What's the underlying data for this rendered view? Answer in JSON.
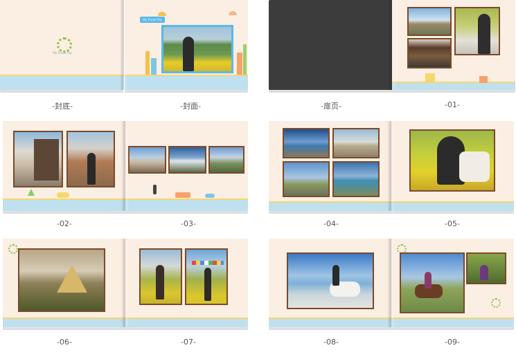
{
  "labels": {
    "back_cover": "-封底-",
    "front_cover": "-封面-",
    "title_page": "-扉页-",
    "p01": "-01-",
    "p02": "-02-",
    "p03": "-03-",
    "p04": "-04-",
    "p05": "-05-",
    "p06": "-06-",
    "p07": "-07-",
    "p08": "-08-",
    "p09": "-09-"
  },
  "cover": {
    "back_caption": "My Travel Trip",
    "front_caption": "My Travel Trip"
  },
  "colors": {
    "page": "#fbeee3",
    "stripe": "#bfe0ef",
    "frame": "#7a4a2a",
    "accent_blue": "#5bb8e8"
  }
}
